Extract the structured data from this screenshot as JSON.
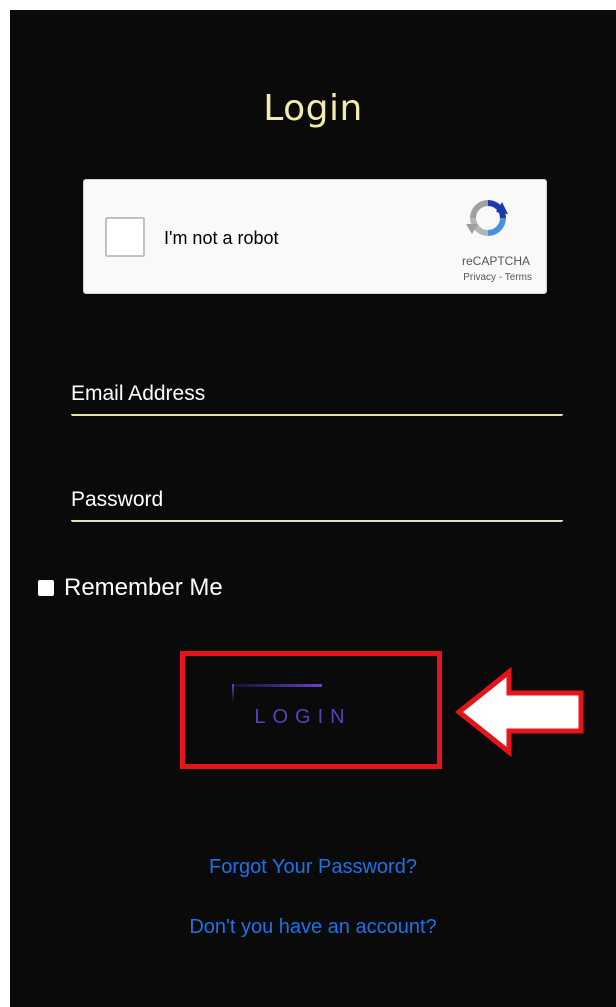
{
  "title": "Login",
  "captcha": {
    "label": "I'm not a robot",
    "brand": "reCAPTCHA",
    "privacy": "Privacy",
    "separator": " - ",
    "terms": "Terms"
  },
  "form": {
    "email_label": "Email Address",
    "email_value": "",
    "password_label": "Password",
    "password_value": "",
    "remember_label": "Remember Me",
    "remember_checked": false
  },
  "login_button": {
    "label": "LOGIN"
  },
  "links": {
    "forgot": "Forgot Your Password?",
    "signup": "Don't you have an account?"
  },
  "annotation": {
    "highlight_color": "#e3151a",
    "arrow_direction": "left"
  },
  "colors": {
    "background": "#0a0a0a",
    "title": "#f2eab0",
    "underline": "#e8e2b0",
    "button_text": "#5b3fbf",
    "link": "#1a73e8"
  }
}
